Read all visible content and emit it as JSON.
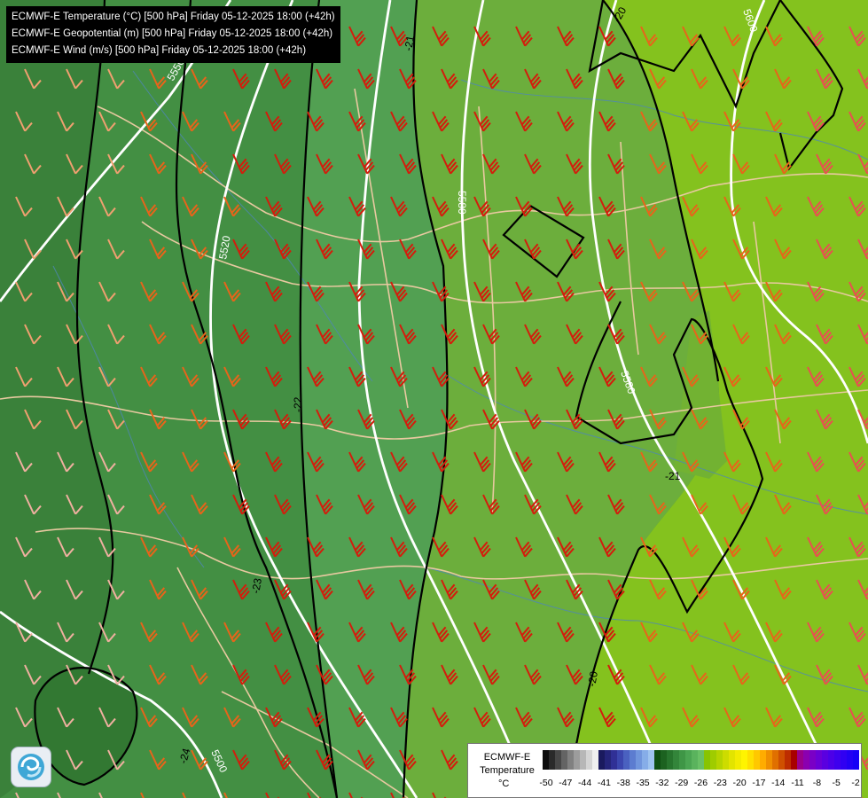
{
  "titles": [
    "ECMWF-E Temperature (°C) [500 hPa] Friday 05-12-2025 18:00 (+42h)",
    "ECMWF-E Geopotential (m) [500 hPa] Friday 05-12-2025 18:00 (+42h)",
    "ECMWF-E Wind (m/s) [500 hPa] Friday 05-12-2025 18:00 (+42h)"
  ],
  "map": {
    "temperature_zones_c": [
      -24,
      -23,
      -22,
      -21,
      -20
    ],
    "isotherm_labels": [
      "-24",
      "-23",
      "-22",
      "-21",
      "-20",
      "-21",
      "-20"
    ],
    "geopotential_labels": [
      "5500",
      "5520",
      "5550",
      "5580",
      "5580",
      "5600"
    ],
    "wind": "barbs from the southwest, stronger (red) in the central corridor"
  },
  "legend": {
    "title": "ECMWF-E Temperature",
    "unit": "°C",
    "ticks": [
      "-50",
      "-47",
      "-44",
      "-41",
      "-38",
      "-35",
      "-32",
      "-29",
      "-26",
      "-23",
      "-20",
      "-17",
      "-14",
      "-11",
      "-8",
      "-5",
      "-2"
    ],
    "colors": [
      "#0d0d0d",
      "#2a2a2a",
      "#474747",
      "#646464",
      "#808080",
      "#9c9c9c",
      "#b7b7b7",
      "#d4d4d4",
      "#efefef",
      "#1a1a5e",
      "#25257a",
      "#303096",
      "#3b46ae",
      "#4a61c0",
      "#5c7cd0",
      "#7095dd",
      "#86ade8",
      "#9fc4f0",
      "#0f4f12",
      "#1c6220",
      "#27742d",
      "#33853a",
      "#3f9646",
      "#4ba552",
      "#5ab35d",
      "#69c066",
      "#88c400",
      "#9fcc00",
      "#b6d400",
      "#cddc00",
      "#e2e400",
      "#f3ec00",
      "#fff400",
      "#ffe000",
      "#ffc800",
      "#ffac00",
      "#f08f00",
      "#e07000",
      "#cf5000",
      "#bd2d00",
      "#a80000",
      "#9a008a",
      "#8b00b0",
      "#7a00c6",
      "#6a00d6",
      "#5a00e0",
      "#4c00e8",
      "#3e00ee",
      "#3000f2",
      "#2200f4",
      "#1600f6"
    ]
  }
}
